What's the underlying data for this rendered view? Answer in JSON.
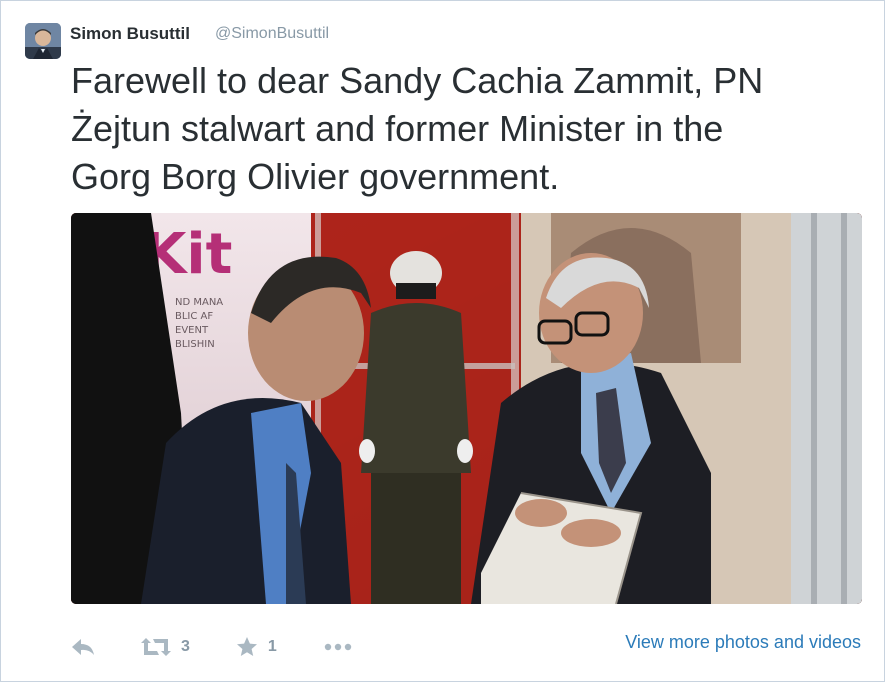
{
  "author": {
    "name": "Simon Busuttil",
    "handle": "@SimonBusuttil"
  },
  "tweet": {
    "text": "Farewell to dear Sandy Cachia Zammit, PN\nŻejtun stalwart and former Minister in the\nGorg Borg Olivier government."
  },
  "media": {
    "icon": "photo",
    "banner_text": [
      "ND MANA",
      "BLIC AF",
      "EVENT",
      "BLISHIN"
    ]
  },
  "actions": {
    "reply_icon": "reply-icon",
    "retweet_icon": "retweet-icon",
    "retweet_count": "3",
    "favorite_icon": "star-icon",
    "favorite_count": "1",
    "more_icon": "more-icon"
  },
  "links": {
    "view_more": "View more photos and videos"
  },
  "colors": {
    "link": "#2b7bb9",
    "text": "#292f33",
    "muted": "#8899a6",
    "icon": "#aab8c2",
    "border": "#c8d3df"
  }
}
